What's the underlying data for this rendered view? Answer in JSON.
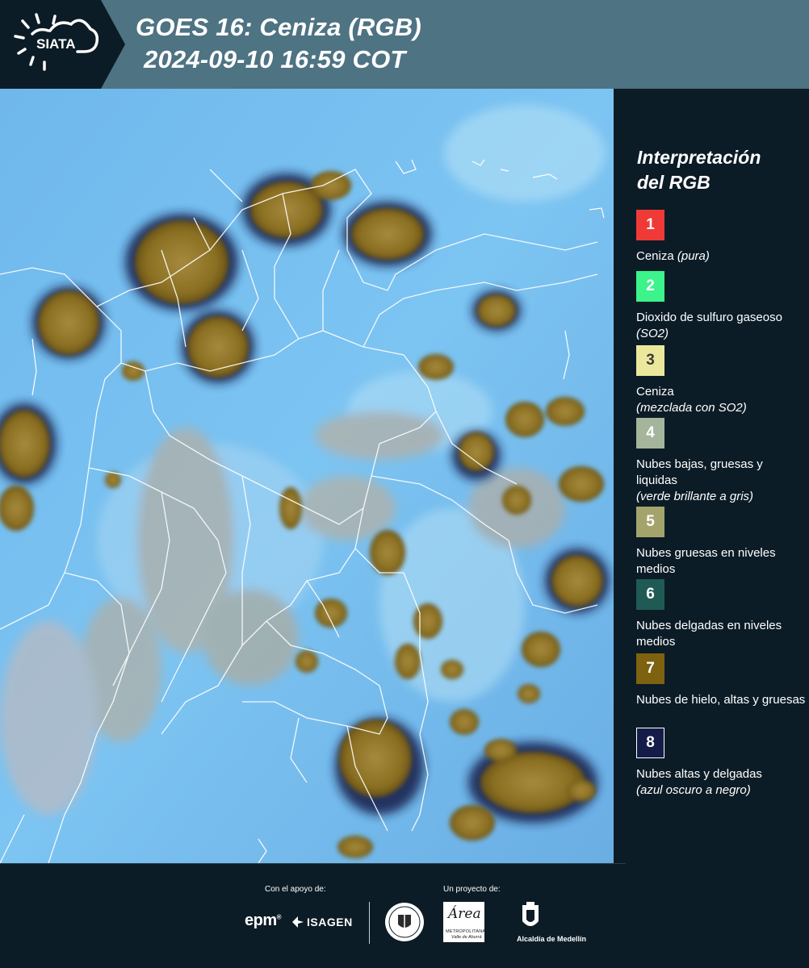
{
  "header": {
    "logo_text": "SIATA",
    "title_line1": "GOES 16: Ceniza (RGB)",
    "title_line2": "2024-09-10 16:59 COT"
  },
  "legend": {
    "title_line1": "Interpretación",
    "title_line2": "del RGB",
    "items": [
      {
        "number": "1",
        "color": "#f03a38",
        "label": "Ceniza ",
        "note": "(pura)"
      },
      {
        "number": "2",
        "color": "#3cf38c",
        "label": "Dioxido de sulfuro gaseoso ",
        "note": "(SO2)"
      },
      {
        "number": "3",
        "color": "#ebe89c",
        "label": "Ceniza",
        "note": "(mezclada con SO2)"
      },
      {
        "number": "4",
        "color": "#a4b59b",
        "label": "Nubes bajas, gruesas y liquidas",
        "note": "(verde brillante a gris)"
      },
      {
        "number": "5",
        "color": "#a4a36b",
        "label": "Nubes gruesas en niveles medios",
        "note": ""
      },
      {
        "number": "6",
        "color": "#1f5b54",
        "label": "Nubes delgadas en niveles medios",
        "note": ""
      },
      {
        "number": "7",
        "color": "#7e6210",
        "label": "Nubes de hielo, altas y gruesas",
        "note": ""
      },
      {
        "number": "8",
        "color": "#151c4a",
        "label": "Nubes altas y delgadas",
        "note": "(azul oscuro a negro)"
      }
    ]
  },
  "footer": {
    "support_label": "Con el apoyo de:",
    "project_label": "Un proyecto de:",
    "epm": "epm",
    "isagen": "ISAGEN",
    "area_title": "Área",
    "area_sub1": "METROPOLITANA",
    "area_sub2": "Valle de Aburrá",
    "alcaldia": "Alcaldía de Medellín"
  }
}
